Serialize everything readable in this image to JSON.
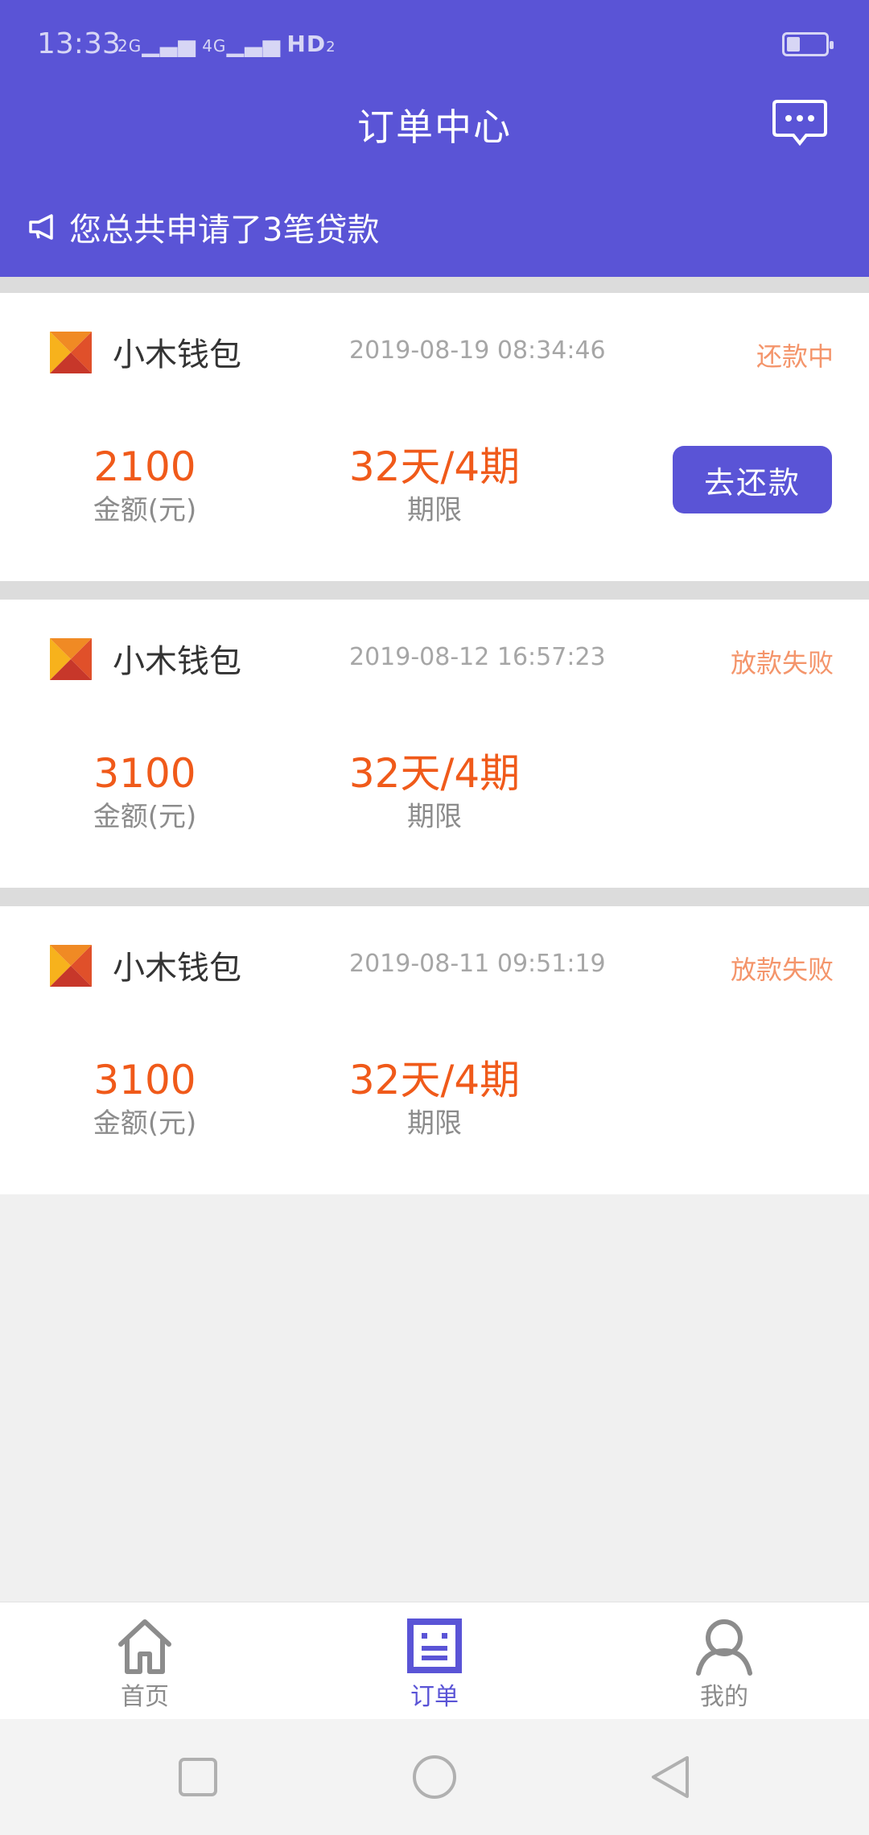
{
  "status_bar": {
    "time": "13:33",
    "signal_text_1": "2G",
    "signal_text_2": "4G",
    "hd_text": "HD",
    "hd_index": "2"
  },
  "header": {
    "title": "订单中心",
    "notice": "您总共申请了3笔贷款"
  },
  "orders": [
    {
      "name": "小木钱包",
      "date": "2019-08-19 08:34:46",
      "status": "还款中",
      "amount": "2100",
      "amount_caption": "金额(元)",
      "term": "32天/4期",
      "term_caption": "期限",
      "action": "去还款"
    },
    {
      "name": "小木钱包",
      "date": "2019-08-12 16:57:23",
      "status": "放款失败",
      "amount": "3100",
      "amount_caption": "金额(元)",
      "term": "32天/4期",
      "term_caption": "期限"
    },
    {
      "name": "小木钱包",
      "date": "2019-08-11 09:51:19",
      "status": "放款失败",
      "amount": "3100",
      "amount_caption": "金额(元)",
      "term": "32天/4期",
      "term_caption": "期限"
    }
  ],
  "tabs": [
    {
      "label": "首页",
      "icon": "home-icon"
    },
    {
      "label": "订单",
      "icon": "order-icon",
      "active": true
    },
    {
      "label": "我的",
      "icon": "user-icon"
    }
  ],
  "colors": {
    "brand": "#5a54d6",
    "status": "#f4956b",
    "value": "#f05a1a"
  }
}
